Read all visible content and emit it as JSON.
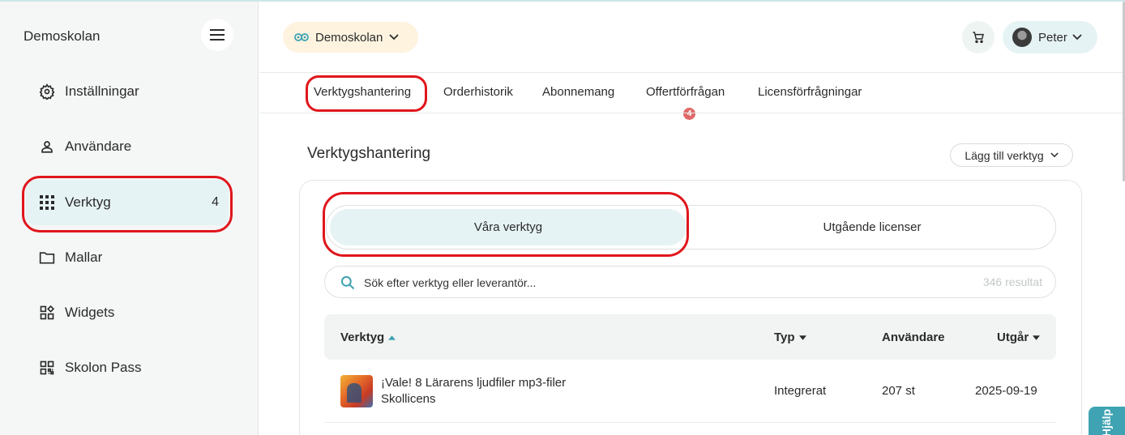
{
  "sidebar": {
    "brand": "Demoskolan",
    "items": [
      {
        "label": "Inställningar",
        "icon": "gear-icon"
      },
      {
        "label": "Användare",
        "icon": "user-icon"
      },
      {
        "label": "Verktyg",
        "icon": "grid-icon",
        "count": "4",
        "active": true
      },
      {
        "label": "Mallar",
        "icon": "folder-icon"
      },
      {
        "label": "Widgets",
        "icon": "widgets-icon"
      },
      {
        "label": "Skolon Pass",
        "icon": "qr-icon"
      }
    ]
  },
  "header": {
    "school_selector": "Demoskolan",
    "user_name": "Peter"
  },
  "tabs": [
    {
      "label": "Verktygshantering",
      "active": true
    },
    {
      "label": "Orderhistorik"
    },
    {
      "label": "Abonnemang"
    },
    {
      "label": "Offertförfrågan",
      "badge": "4"
    },
    {
      "label": "Licensförfrågningar"
    }
  ],
  "main": {
    "title": "Verktygshantering",
    "add_tool_label": "Lägg till verktyg",
    "segment": {
      "active": "Våra verktyg",
      "inactive": "Utgående licenser"
    },
    "search": {
      "placeholder": "Sök efter verktyg eller leverantör...",
      "results": "346 resultat"
    },
    "table": {
      "columns": [
        "Verktyg",
        "Typ",
        "Användare",
        "Utgår"
      ],
      "rows": [
        {
          "title": "¡Vale! 8 Lärarens ljudfiler mp3-filer",
          "subtitle": "Skollicens",
          "type": "Integrerat",
          "users": "207 st",
          "expires": "2025-09-19"
        }
      ]
    }
  },
  "help_label": "Hjälp",
  "colors": {
    "accent": "#3fa3b3",
    "active_bg": "#e6f3f4",
    "annotation": "#e0161c",
    "badge": "#e06a6a"
  }
}
